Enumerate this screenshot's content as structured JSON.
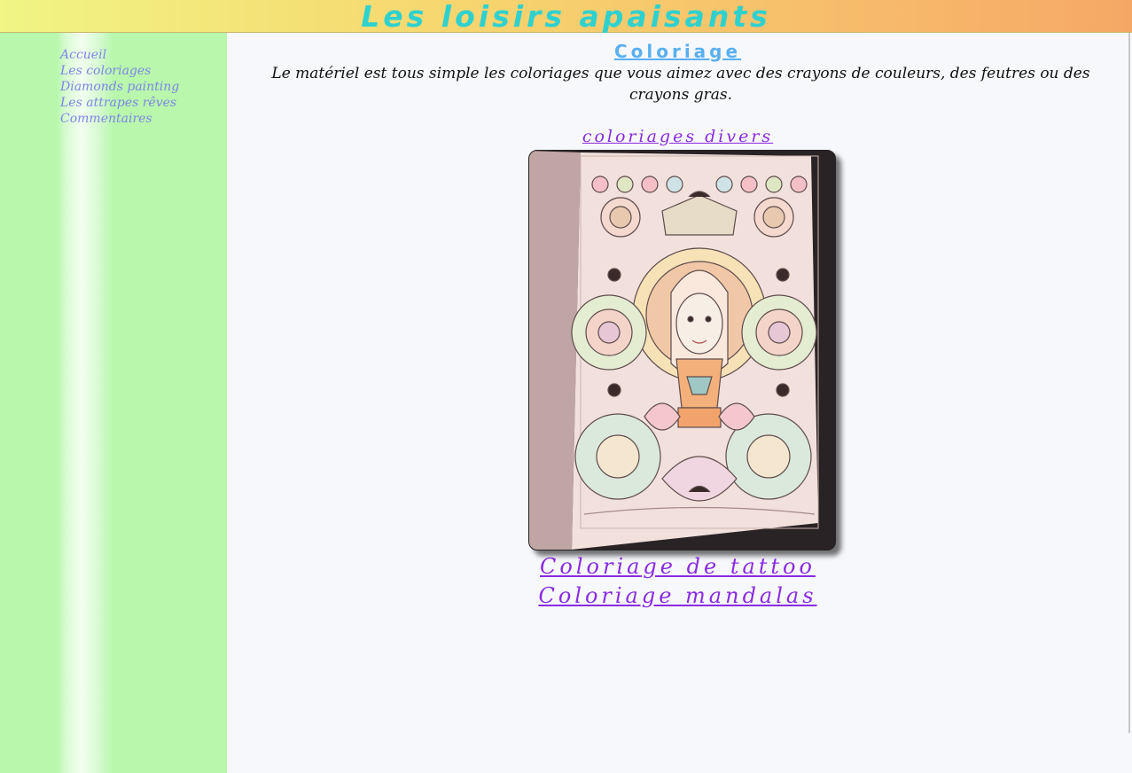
{
  "header": {
    "title": "Les loisirs apaisants"
  },
  "sidebar": {
    "items": [
      {
        "label": "Accueil"
      },
      {
        "label": "Les coloriages"
      },
      {
        "label": "Diamonds painting"
      },
      {
        "label": "Les attrapes rêves"
      },
      {
        "label": "Commentaires"
      }
    ]
  },
  "main": {
    "section_title": "Coloriage",
    "intro": "Le matériel est tous simple les coloriages que vous aimez avec des crayons de couleurs, des feutres ou des crayons gras.",
    "links": {
      "divers": "coloriages divers",
      "tattoo": "Coloriage de tattoo",
      "mandalas": "Coloriage mandalas"
    },
    "photo": {
      "subject": "coloring-page-photo"
    }
  },
  "colors": {
    "title": "#2fd1cf",
    "nav": "#7d86e8",
    "section_title": "#5ab0f0",
    "link": "#8a2be2",
    "sidebar": "#b8f7ac"
  }
}
